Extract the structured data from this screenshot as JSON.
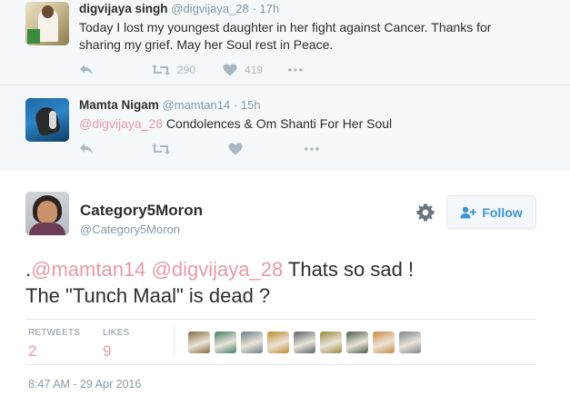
{
  "replies": [
    {
      "name": "digvijaya singh",
      "handle": "@digvijaya_28",
      "time": "17h",
      "text_line1": "Today I lost my youngest daughter in her fight against Cancer. Thanks for",
      "text_line2": "sharing my grief. May her Soul rest in Peace.",
      "retweets": "290",
      "likes": "419"
    },
    {
      "name": "Mamta Nigam",
      "handle": "@mamtan14",
      "time": "15h",
      "mention": "@digvijaya_28",
      "text": " Condolences & Om Shanti For Her Soul"
    }
  ],
  "main_tweet": {
    "name": "Category5Moron",
    "handle": "@Category5Moron",
    "follow_label": "Follow",
    "text_prefix": ".",
    "mention1": "@mamtan14",
    "mention2": "@digvijaya_28",
    "text_line1_rest": " Thats so sad !",
    "text_line2": "The \"Tunch Maal\" is dead ?",
    "stats": {
      "retweets_label": "RETWEETS",
      "retweets_value": "2",
      "likes_label": "LIKES",
      "likes_value": "9"
    },
    "liker_avatar_colors": [
      "#8a6a3c",
      "#3f7f6a",
      "#6d7c88",
      "#c48a2a",
      "#5a5f66",
      "#9a8a3a",
      "#4d5a4a",
      "#d08a3a",
      "#7a8590"
    ],
    "timestamp": "8:47 AM - 29 Apr 2016"
  },
  "colors": {
    "mention": "#e89aa5",
    "follow_accent": "#3b94d9",
    "muted": "#8899a6",
    "icon": "#aab8c2"
  },
  "icons": [
    "reply-icon",
    "retweet-icon",
    "like-icon",
    "more-icon",
    "gear-icon",
    "follow-user-icon"
  ]
}
